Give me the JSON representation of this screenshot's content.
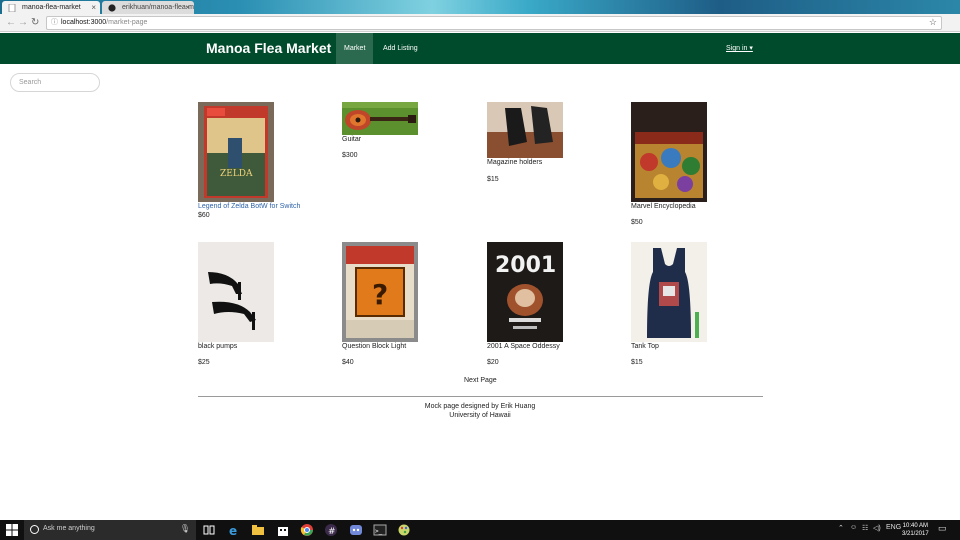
{
  "browser": {
    "tabs": [
      {
        "label": "manoa-flea-market",
        "active": true
      },
      {
        "label": "erikhuan/manoa-flea-m",
        "active": false
      }
    ],
    "url_host": "localhost:3000",
    "url_path": "/market-page"
  },
  "navbar": {
    "brand": "Manoa Flea Market",
    "market_label": "Market",
    "add_listing_label": "Add Listing",
    "sign_in_label": "Sign in ▾",
    "bg_color": "#004b2c"
  },
  "search": {
    "placeholder": "Search"
  },
  "listings": [
    {
      "name": "Legend of Zelda BotW for Switch",
      "price": "$60"
    },
    {
      "name": "Guitar",
      "price": "$300"
    },
    {
      "name": "Magazine holders",
      "price": "$15"
    },
    {
      "name": "Marvel Encyclopedia",
      "price": "$50"
    },
    {
      "name": "black pumps",
      "price": "$25"
    },
    {
      "name": "Question Block Light",
      "price": "$40"
    },
    {
      "name": "2001 A Space Oddessy",
      "price": "$20"
    },
    {
      "name": "Tank Top",
      "price": "$15"
    }
  ],
  "pagination": {
    "next_label": "Next Page"
  },
  "footer": {
    "line1": "Mock page designed by Erik Huang",
    "line2": "University of Hawaii"
  },
  "taskbar": {
    "search_placeholder": "Ask me anything",
    "language": "ENG",
    "time": "10:40 AM",
    "date": "3/21/2017"
  }
}
